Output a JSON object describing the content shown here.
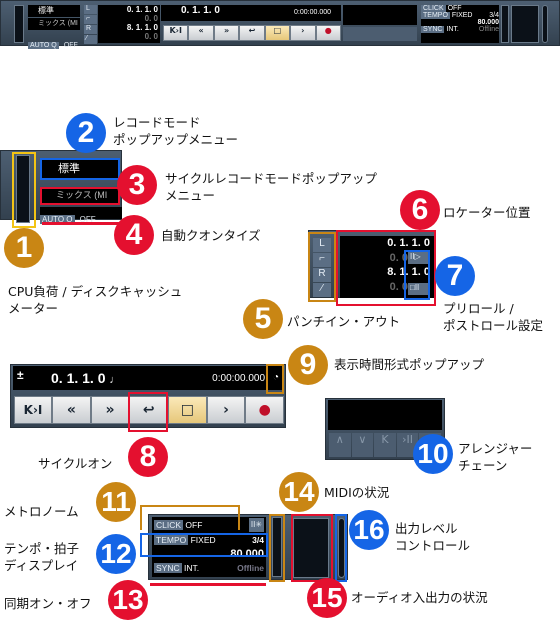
{
  "toolbar": {
    "record_mode": "標準",
    "cycle_record_mode": "ミックス (MI",
    "auto_q_label": "AUTO Q",
    "auto_q_value": "OFF",
    "locators": {
      "left_label": "L",
      "right_label": "R",
      "left_position": "0. 1. 1.   0",
      "preroll": "0.   0",
      "right_position": "8. 1. 1.   0",
      "postroll": "0.   0",
      "preroll_icon": "II▷",
      "postroll_icon": "□II"
    },
    "transport": {
      "position": "0. 1. 1.   0",
      "time": "0:00:00.000",
      "buttons": [
        "K›I",
        "«",
        "»",
        "cycle",
        "stop",
        "play",
        "record"
      ]
    },
    "metronome": {
      "click_label": "CLICK",
      "click_value": "OFF",
      "tempo_label": "TEMPO",
      "tempo_mode": "FIXED",
      "signature": "3/4",
      "tempo": "80.000",
      "sync_label": "SYNC",
      "sync_mode": "INT.",
      "sync_status": "Offline"
    }
  },
  "callouts": [
    {
      "num": "1",
      "text": "CPU負荷 / ディスクキャッシュ\nメーター",
      "color": "#c98614"
    },
    {
      "num": "2",
      "text": "レコードモード\nポップアップメニュー",
      "color": "#1565e6"
    },
    {
      "num": "3",
      "text": "サイクルレコードモードポップアップ\nメニュー",
      "color": "#e4102f"
    },
    {
      "num": "4",
      "text": "自動クオンタイズ",
      "color": "#e4102f"
    },
    {
      "num": "5",
      "text": "パンチイン・アウト",
      "color": "#c98614"
    },
    {
      "num": "6",
      "text": "ロケーター位置",
      "color": "#e4102f"
    },
    {
      "num": "7",
      "text": "プリロール /\nポストロール設定",
      "color": "#1565e6"
    },
    {
      "num": "8",
      "text": "サイクルオン",
      "color": "#e4102f"
    },
    {
      "num": "9",
      "text": "表示時間形式ポップアップ",
      "color": "#c98614"
    },
    {
      "num": "10",
      "text": "アレンジャー\nチェーン",
      "color": "#1565e6"
    },
    {
      "num": "11",
      "text": "メトロノーム",
      "color": "#c98614"
    },
    {
      "num": "12",
      "text": "テンポ・拍子\nディスプレイ",
      "color": "#1565e6"
    },
    {
      "num": "13",
      "text": "同期オン・オフ",
      "color": "#e4102f"
    },
    {
      "num": "14",
      "text": "MIDIの状況",
      "color": "#c98614"
    },
    {
      "num": "15",
      "text": "オーディオ入出力の状況",
      "color": "#e4102f"
    },
    {
      "num": "16",
      "text": "出力レベル\nコントロール",
      "color": "#1565e6"
    }
  ]
}
